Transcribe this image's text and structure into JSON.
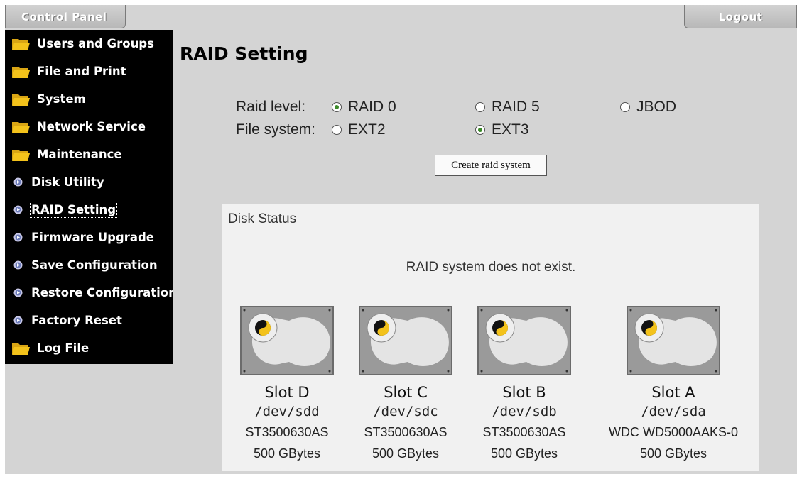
{
  "header": {
    "control_panel_label": "Control Panel",
    "logout_label": "Logout"
  },
  "sidebar": {
    "items": [
      {
        "label": "Users and Groups",
        "icon": "folder-icon"
      },
      {
        "label": "File and Print",
        "icon": "folder-icon"
      },
      {
        "label": "System",
        "icon": "folder-icon"
      },
      {
        "label": "Network Service",
        "icon": "folder-icon"
      },
      {
        "label": "Maintenance",
        "icon": "folder-icon"
      },
      {
        "label": "Disk Utility",
        "icon": "circle-arrow-icon"
      },
      {
        "label": "RAID Setting",
        "icon": "circle-arrow-icon",
        "selected": true
      },
      {
        "label": "Firmware Upgrade",
        "icon": "circle-arrow-icon"
      },
      {
        "label": "Save Configuration",
        "icon": "circle-arrow-icon"
      },
      {
        "label": "Restore Configuration",
        "icon": "circle-arrow-icon"
      },
      {
        "label": "Factory Reset",
        "icon": "circle-arrow-icon"
      },
      {
        "label": "Log File",
        "icon": "folder-icon"
      }
    ]
  },
  "main": {
    "title": "RAID Setting",
    "raid_level": {
      "label": "Raid level:",
      "options": [
        {
          "label": "RAID 0",
          "checked": true
        },
        {
          "label": "RAID 5",
          "checked": false
        },
        {
          "label": "JBOD",
          "checked": false
        }
      ]
    },
    "file_system": {
      "label": "File system:",
      "options": [
        {
          "label": "EXT2",
          "checked": false
        },
        {
          "label": "EXT3",
          "checked": true
        }
      ]
    },
    "create_button_label": "Create raid system",
    "disk_status": {
      "title": "Disk Status",
      "message": "RAID system does not exist.",
      "slots": [
        {
          "name": "Slot D",
          "device": "/dev/sdd",
          "model": "ST3500630AS",
          "size": "500 GBytes"
        },
        {
          "name": "Slot C",
          "device": "/dev/sdc",
          "model": "ST3500630AS",
          "size": "500 GBytes"
        },
        {
          "name": "Slot B",
          "device": "/dev/sdb",
          "model": "ST3500630AS",
          "size": "500 GBytes"
        },
        {
          "name": "Slot A",
          "device": "/dev/sda",
          "model": "WDC WD5000AAKS-0",
          "size": "500 GBytes"
        }
      ]
    }
  },
  "colors": {
    "sidebar_bg": "#000000",
    "content_bg": "#d4d4d4",
    "panel_bg": "#f1f1f1",
    "folder_yellow": "#f3c21b",
    "radio_checked": "#3c8a2a"
  }
}
